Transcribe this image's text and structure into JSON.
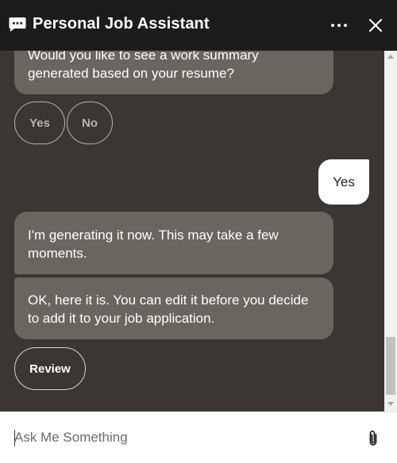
{
  "header": {
    "title": "Personal Job Assistant",
    "chat_icon": "chat-bubble-icon",
    "more_icon": "more-horizontal-icon",
    "close_icon": "close-icon"
  },
  "conversation": {
    "messages": [
      {
        "from": "bot",
        "text": "Would you like to see a work summary generated based on your resume?"
      },
      {
        "from": "user",
        "text": "Yes"
      },
      {
        "from": "bot",
        "text": "I'm generating it now. This may take a few moments."
      },
      {
        "from": "bot",
        "text": "OK, here it is. You can edit it before you decide to add it to your job application."
      }
    ],
    "quick_replies": [
      "Yes",
      "No"
    ],
    "action_button": "Review"
  },
  "composer": {
    "placeholder": "Ask Me Something",
    "attach_icon": "paperclip-icon"
  },
  "colors": {
    "header_bg": "#1e1c1a",
    "conversation_bg": "#3a3632",
    "bot_bubble": "#6b6560",
    "user_bubble": "#ffffff"
  }
}
